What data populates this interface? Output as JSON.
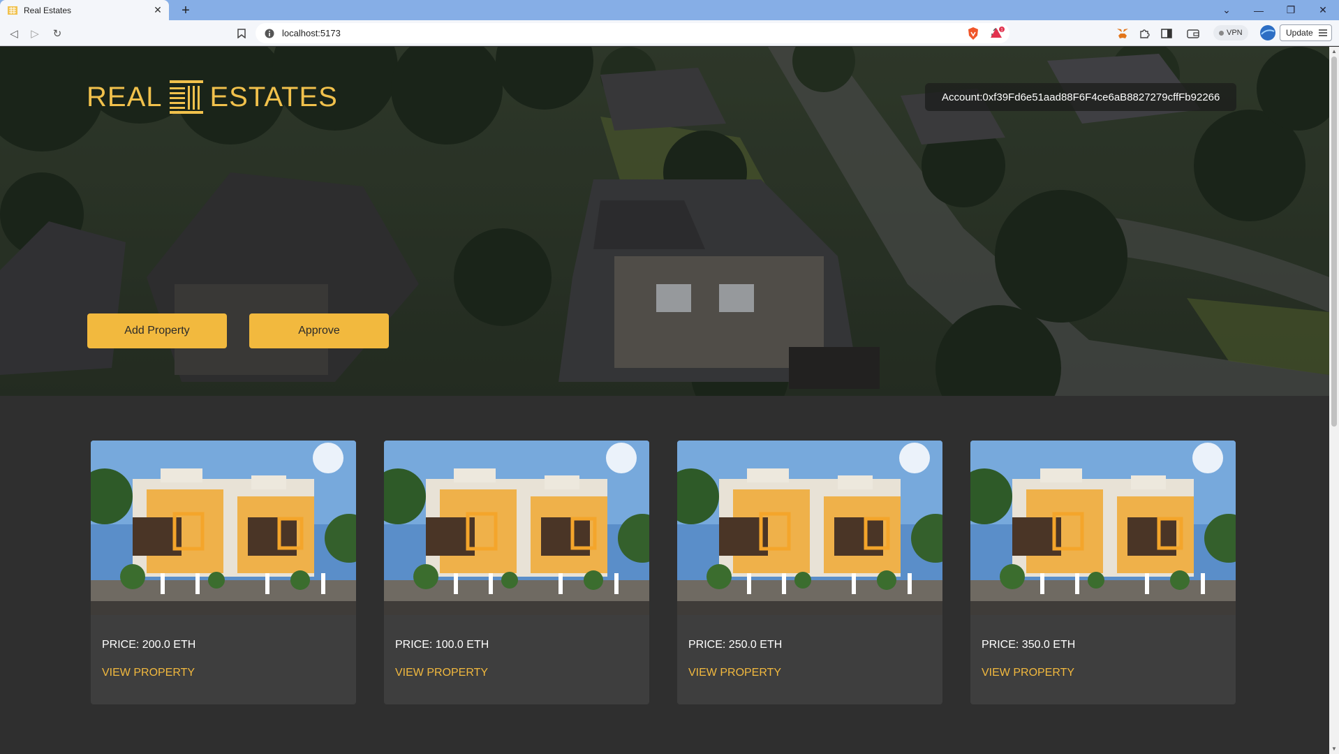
{
  "browser": {
    "tab_title": "Real Estates",
    "tab_close": "✕",
    "new_tab": "+",
    "url": "localhost:5173",
    "vpn_label": "VPN",
    "update_label": "Update",
    "notification_count": "1",
    "window_controls": {
      "dropdown": "⌄",
      "minimize": "—",
      "restore": "❐",
      "close": "✕"
    },
    "nav": {
      "back": "◁",
      "forward": "▷",
      "reload": "↻"
    }
  },
  "header": {
    "logo_left": "REAL",
    "logo_right": "ESTATES",
    "account": "Account:0xf39Fd6e51aad88F6F4ce6aB8827279cffFb92266"
  },
  "hero": {
    "add_property_label": "Add Property",
    "approve_label": "Approve"
  },
  "properties": [
    {
      "price": "PRICE: 200.0 ETH",
      "link": "VIEW PROPERTY"
    },
    {
      "price": "PRICE: 100.0 ETH",
      "link": "VIEW PROPERTY"
    },
    {
      "price": "PRICE: 250.0 ETH",
      "link": "VIEW PROPERTY"
    },
    {
      "price": "PRICE: 350.0 ETH",
      "link": "VIEW PROPERTY"
    }
  ],
  "colors": {
    "accent": "#f2b93e",
    "logo": "#f1c14c",
    "page_bg": "#2f2f2f",
    "card_bg": "#3e3e3e",
    "tabbar": "#86aee6"
  }
}
